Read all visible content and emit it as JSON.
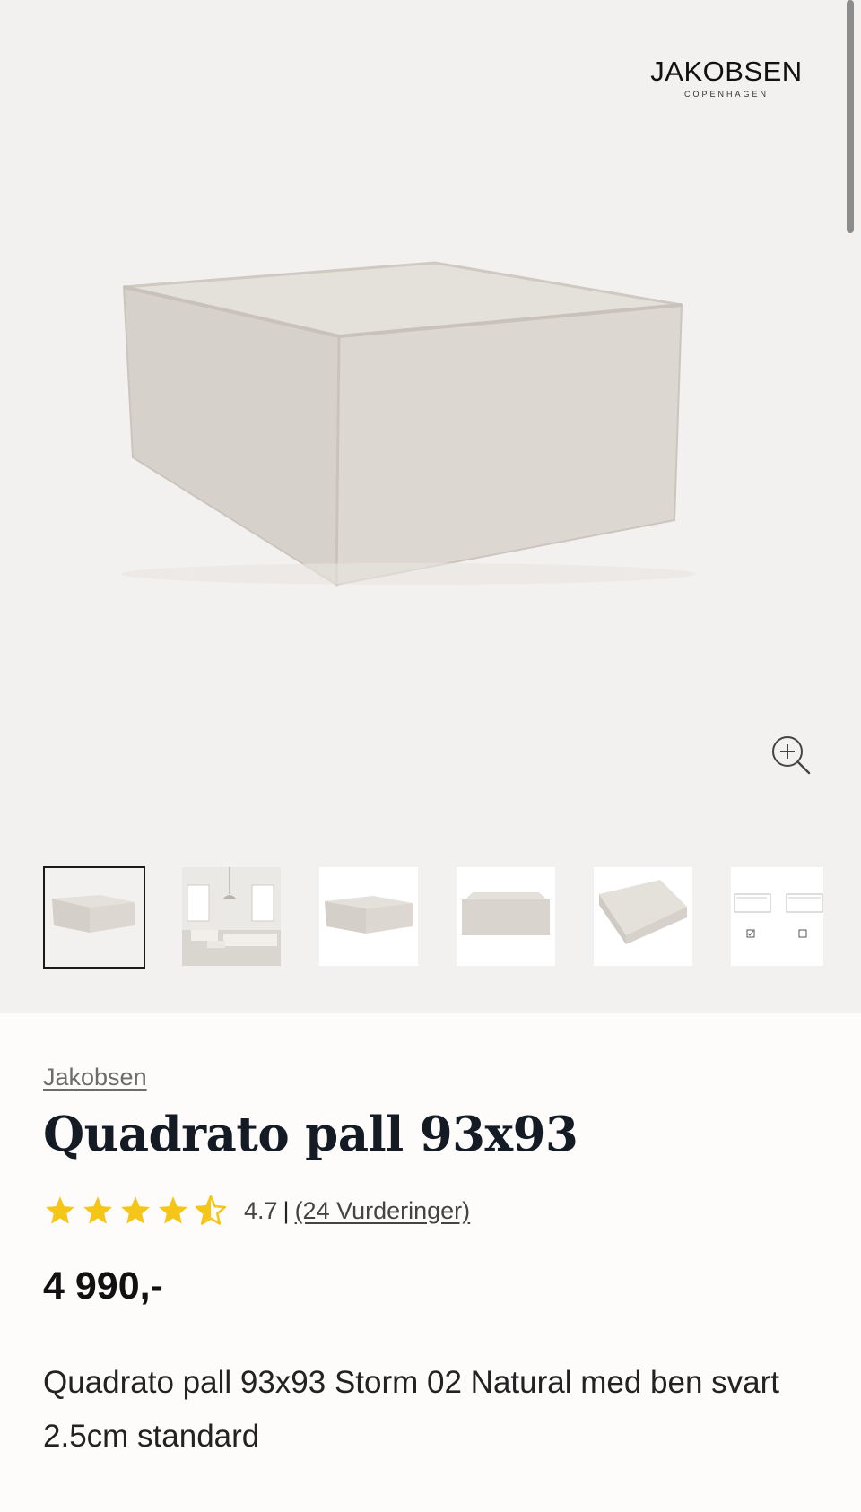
{
  "logo": {
    "wordmark": "JAKOBSEN",
    "tagline": "COPENHAGEN"
  },
  "gallery": {
    "zoom_icon": "zoom-in-icon",
    "thumbnails": [
      {
        "icon": "ottoman-front-image",
        "selected": true
      },
      {
        "icon": "living-room-image",
        "selected": false
      },
      {
        "icon": "ottoman-side-image",
        "selected": false
      },
      {
        "icon": "ottoman-flat-image",
        "selected": false
      },
      {
        "icon": "ottoman-top-image",
        "selected": false
      },
      {
        "icon": "leg-options-image",
        "selected": false
      }
    ]
  },
  "product": {
    "brand": "Jakobsen",
    "title": "Quadrato pall 93x93",
    "rating": {
      "stars": 4.5,
      "value": "4.7",
      "separator": "|",
      "count_label": "(24 Vurderinger)"
    },
    "price": "4 990,-",
    "description": "Quadrato pall 93x93 Storm 02 Natural med ben svart 2.5cm standard"
  },
  "colors": {
    "star": "#f5c518",
    "gallery_bg": "#f3f1ef",
    "fabric": "#d9d4cd"
  }
}
